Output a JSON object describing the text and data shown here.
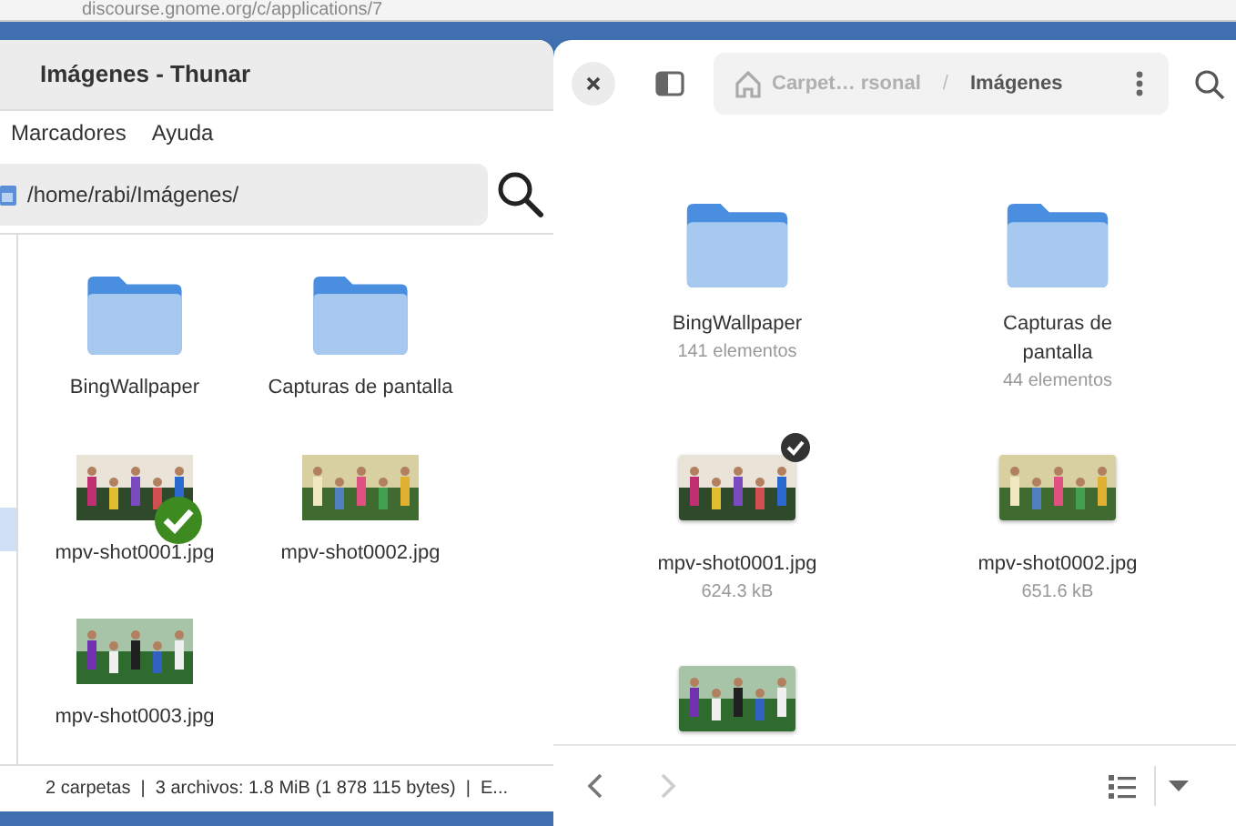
{
  "browser": {
    "url": "discourse.gnome.org/c/applications/7"
  },
  "thunar": {
    "title": "Imágenes - Thunar",
    "menu": [
      "Marcadores",
      "Ayuda"
    ],
    "location": "/home/rabi/Imágenes/",
    "sidebar": [
      {
        "selected": false
      },
      {
        "selected": true
      }
    ],
    "items": [
      {
        "kind": "folder",
        "name": "BingWallpaper",
        "emblem": false
      },
      {
        "kind": "folder",
        "name": "Capturas de pantalla",
        "emblem": false
      },
      {
        "kind": "picture",
        "name": "mpv-shot0001.jpg",
        "emblem": true
      },
      {
        "kind": "picture",
        "name": "mpv-shot0002.jpg",
        "emblem": false
      },
      {
        "kind": "picture",
        "name": "mpv-shot0003.jpg",
        "emblem": false
      }
    ],
    "status": "2 carpetas  |  3 archivos: 1.8 MiB (1 878 115 bytes)  |  E..."
  },
  "nautilus": {
    "path": [
      {
        "label": "Carpet… rsonal",
        "current": false
      },
      {
        "label": "Imágenes",
        "current": true
      }
    ],
    "separator": "/",
    "items": [
      {
        "kind": "folder",
        "name": "BingWallpaper",
        "detail": "141 elementos",
        "selected": false
      },
      {
        "kind": "folder",
        "name": "Capturas de pantalla",
        "detail": "44 elementos",
        "selected": false
      },
      {
        "kind": "picture",
        "name": "mpv-shot0001.jpg",
        "detail": "624.3 kB",
        "selected": true
      },
      {
        "kind": "picture",
        "name": "mpv-shot0002.jpg",
        "detail": "651.6 kB",
        "selected": false
      },
      {
        "kind": "picture",
        "selected": false
      }
    ]
  }
}
